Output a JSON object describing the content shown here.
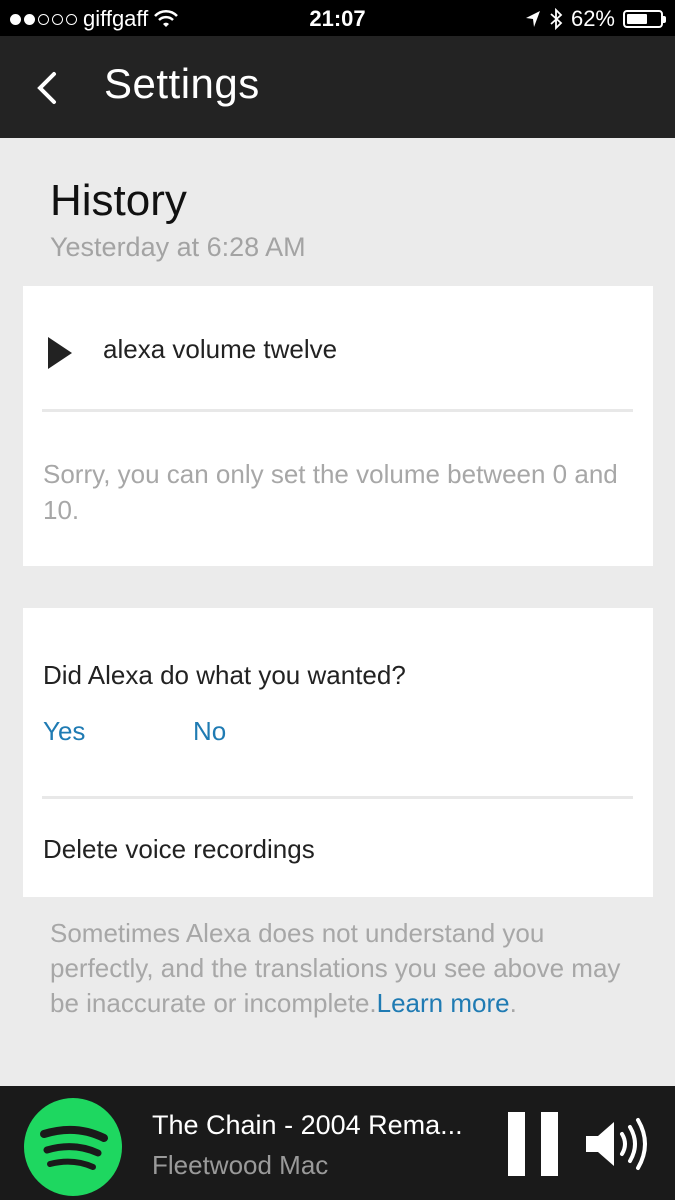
{
  "status_bar": {
    "carrier": "giffgaff",
    "time": "21:07",
    "battery_percent": "62%",
    "battery_level": 0.62,
    "signal_bars_filled": 2,
    "signal_bars_total": 5
  },
  "header": {
    "title": "Settings",
    "back_icon": "chevron-left-icon"
  },
  "history": {
    "title": "History",
    "timestamp": "Yesterday at 6:28 AM"
  },
  "entry": {
    "utterance": "alexa volume twelve",
    "response": "Sorry, you can only set the volume between 0 and 10."
  },
  "feedback": {
    "question": "Did Alexa do what you wanted?",
    "yes_label": "Yes",
    "no_label": "No",
    "delete_label": "Delete voice recordings"
  },
  "footnote": {
    "text": "Sometimes Alexa does not understand you perfectly, and the translations you see above may be inaccurate or incomplete.",
    "link_label": "Learn more",
    "suffix": "."
  },
  "player": {
    "track": "The Chain - 2004 Rema...",
    "artist": "Fleetwood Mac",
    "app_icon": "spotify-icon"
  },
  "colors": {
    "link": "#1f7bb3",
    "header_bg": "#232323",
    "spotify_green": "#1ed760"
  }
}
